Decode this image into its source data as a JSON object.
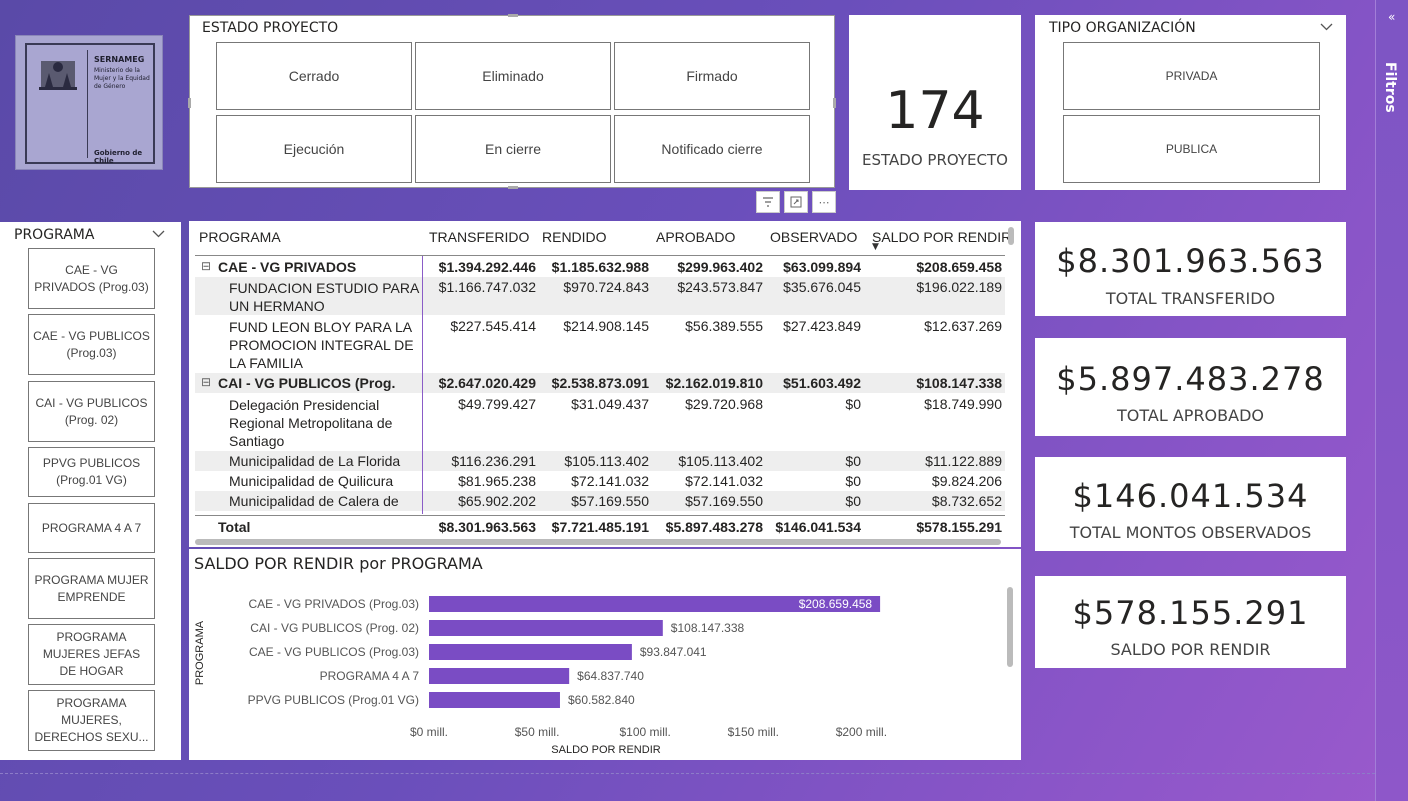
{
  "logo": {
    "title": "SERNAMEG",
    "subtitle": "Ministerio de la Mujer y la Equidad de Género",
    "footer": "Gobierno de Chile"
  },
  "estado": {
    "title": "ESTADO PROYECTO",
    "options": [
      "Cerrado",
      "Eliminado",
      "Firmado",
      "Ejecución",
      "En cierre",
      "Notificado cierre"
    ]
  },
  "count_card": {
    "value": "174",
    "label": "ESTADO PROYECTO"
  },
  "tipo": {
    "title": "TIPO ORGANIZACIÓN",
    "options": [
      "PRIVADA",
      "PUBLICA"
    ]
  },
  "filters_pane": {
    "label": "Filtros"
  },
  "programa_slicer": {
    "title": "PROGRAMA",
    "items": [
      "CAE - VG PRIVADOS (Prog.03)",
      "CAE - VG PUBLICOS (Prog.03)",
      "CAI - VG PUBLICOS (Prog. 02)",
      "PPVG PUBLICOS (Prog.01 VG)",
      "PROGRAMA 4 A 7",
      "PROGRAMA MUJER EMPRENDE",
      "PROGRAMA MUJERES JEFAS DE HOGAR",
      "PROGRAMA MUJERES, DERECHOS SEXU..."
    ]
  },
  "table": {
    "columns": [
      "PROGRAMA",
      "TRANSFERIDO",
      "RENDIDO",
      "APROBADO",
      "OBSERVADO",
      "SALDO POR RENDIR"
    ],
    "rows": [
      {
        "label": "CAE - VG PRIVADOS",
        "values": [
          "$1.394.292.446",
          "$1.185.632.988",
          "$299.963.402",
          "$63.099.894",
          "$208.659.458"
        ]
      },
      {
        "label": "FUNDACION ESTUDIO PARA UN HERMANO",
        "values": [
          "$1.166.747.032",
          "$970.724.843",
          "$243.573.847",
          "$35.676.045",
          "$196.022.189"
        ]
      },
      {
        "label": "FUND LEON BLOY PARA LA PROMOCION INTEGRAL DE LA FAMILIA",
        "values": [
          "$227.545.414",
          "$214.908.145",
          "$56.389.555",
          "$27.423.849",
          "$12.637.269"
        ]
      },
      {
        "label": "CAI - VG PUBLICOS (Prog.",
        "values": [
          "$2.647.020.429",
          "$2.538.873.091",
          "$2.162.019.810",
          "$51.603.492",
          "$108.147.338"
        ]
      },
      {
        "label": "Delegación Presidencial Regional Metropolitana de Santiago",
        "values": [
          "$49.799.427",
          "$31.049.437",
          "$29.720.968",
          "$0",
          "$18.749.990"
        ]
      },
      {
        "label": "Municipalidad de La Florida",
        "values": [
          "$116.236.291",
          "$105.113.402",
          "$105.113.402",
          "$0",
          "$11.122.889"
        ]
      },
      {
        "label": "Municipalidad de Quilicura",
        "values": [
          "$81.965.238",
          "$72.141.032",
          "$72.141.032",
          "$0",
          "$9.824.206"
        ]
      },
      {
        "label": "Municipalidad de Calera de",
        "values": [
          "$65.902.202",
          "$57.169.550",
          "$57.169.550",
          "$0",
          "$8.732.652"
        ]
      }
    ],
    "total": {
      "label": "Total",
      "values": [
        "$8.301.963.563",
        "$7.721.485.191",
        "$5.897.483.278",
        "$146.041.534",
        "$578.155.291"
      ]
    }
  },
  "chart_data": {
    "type": "bar",
    "orientation": "horizontal",
    "title": "SALDO POR RENDIR por PROGRAMA",
    "xlabel": "SALDO POR RENDIR",
    "ylabel": "PROGRAMA",
    "categories": [
      "CAE - VG PRIVADOS (Prog.03)",
      "CAI - VG PUBLICOS (Prog. 02)",
      "CAE - VG PUBLICOS (Prog.03)",
      "PROGRAMA 4 A 7",
      "PPVG PUBLICOS (Prog.01 VG)"
    ],
    "values": [
      208659458,
      108147338,
      93847041,
      64837740,
      60582840
    ],
    "data_labels": [
      "$208.659.458",
      "$108.147.338",
      "$93.847.041",
      "$64.837.740",
      "$60.582.840"
    ],
    "xlim": [
      0,
      210000000
    ],
    "xticks": [
      0,
      50000000,
      100000000,
      150000000,
      200000000
    ],
    "xtick_labels": [
      "$0 mill.",
      "$50 mill.",
      "$100 mill.",
      "$150 mill.",
      "$200 mill."
    ],
    "bar_color": "#7a4cc4"
  },
  "kpis": [
    {
      "value": "$8.301.963.563",
      "label": "TOTAL TRANSFERIDO"
    },
    {
      "value": "$5.897.483.278",
      "label": "TOTAL APROBADO"
    },
    {
      "value": "$146.041.534",
      "label": "TOTAL MONTOS OBSERVADOS"
    },
    {
      "value": "$578.155.291",
      "label": "SALDO POR RENDIR"
    }
  ],
  "colors": {
    "accent": "#7a4cc4",
    "background": "#6a4fbb"
  }
}
